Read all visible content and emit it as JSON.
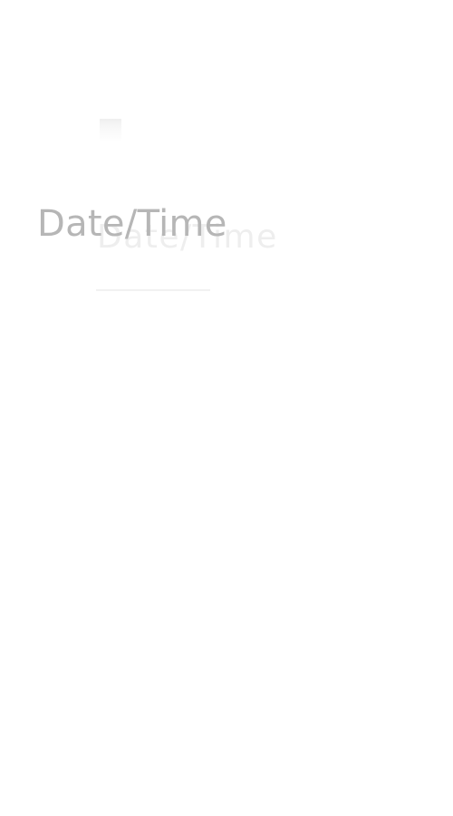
{
  "screen": {
    "title": "Date/Time"
  }
}
